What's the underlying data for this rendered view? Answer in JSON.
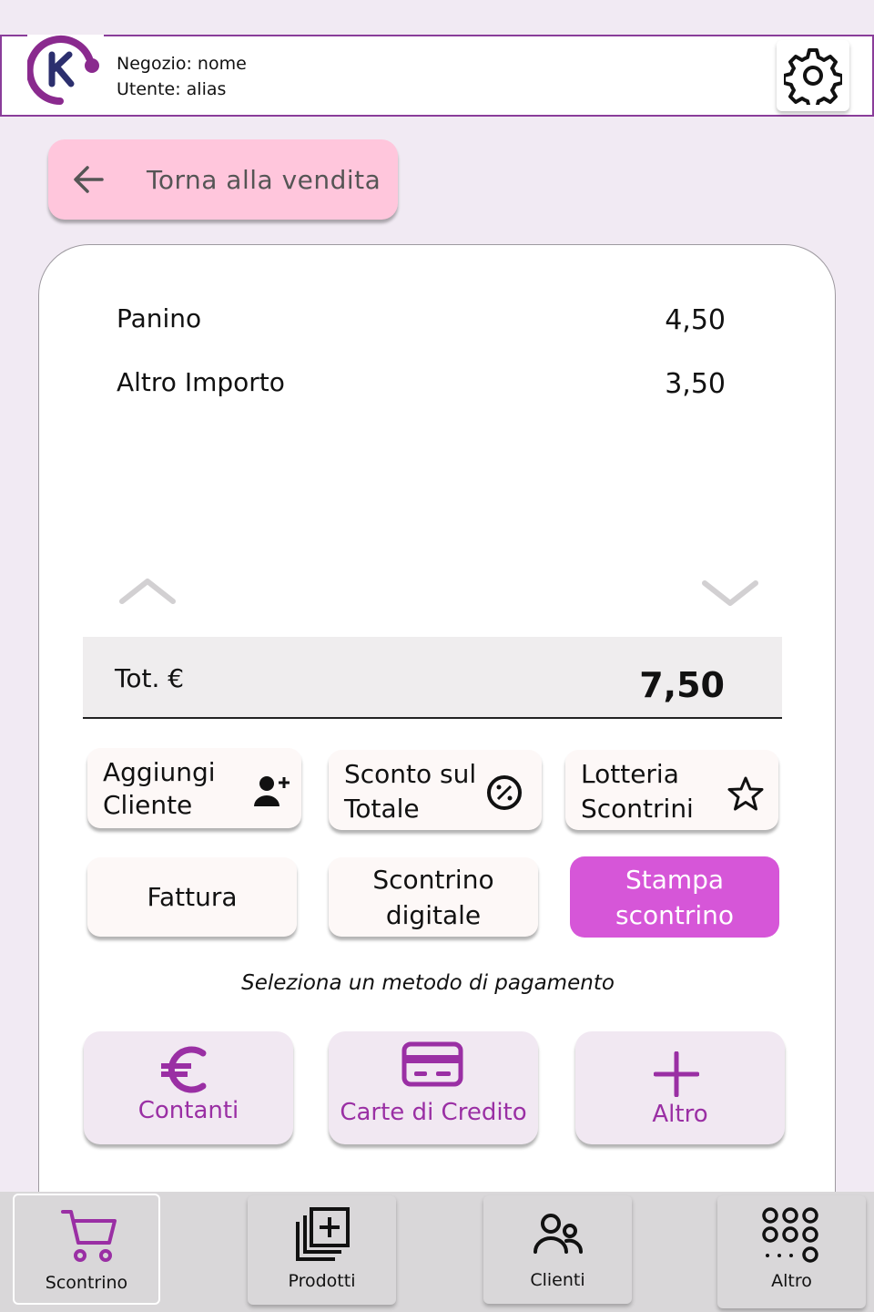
{
  "header": {
    "shop_line": "Negozio: nome",
    "user_line": "Utente: alias"
  },
  "back_button": {
    "label": "Torna  alla vendita"
  },
  "receipt": {
    "items": [
      {
        "name": "Panino",
        "price": "4,50"
      },
      {
        "name": "Altro Importo",
        "price": "3,50"
      }
    ],
    "total_label": "Tot. €",
    "total_value": "7,50"
  },
  "actions": {
    "add_client": {
      "line1": "Aggiungi",
      "line2": "Cliente"
    },
    "discount": {
      "line1": "Sconto sul",
      "line2": "Totale"
    },
    "lottery": {
      "line1": "Lotteria",
      "line2": "Scontrini"
    },
    "invoice": {
      "label": "Fattura"
    },
    "digital_receipt": {
      "line1": "Scontrino",
      "line2": "digitale"
    },
    "print_receipt": {
      "line1": "Stampa",
      "line2": "scontrino"
    }
  },
  "payment": {
    "hint": "Seleziona un metodo di pagamento",
    "methods": [
      {
        "label": "Contanti",
        "icon": "euro-icon"
      },
      {
        "label": "Carte di Credito",
        "icon": "credit-card-icon"
      },
      {
        "label": "Altro",
        "icon": "plus-icon"
      }
    ]
  },
  "nav": {
    "items": [
      {
        "label": "Scontrino",
        "icon": "cart-icon",
        "active": true
      },
      {
        "label": "Prodotti",
        "icon": "products-icon",
        "active": false
      },
      {
        "label": "Clienti",
        "icon": "clients-icon",
        "active": false
      },
      {
        "label": "Altro",
        "icon": "grid-dots-icon",
        "active": false
      }
    ]
  },
  "colors": {
    "brand_purple": "#8a3d9a",
    "accent_magenta": "#d656d8",
    "back_pink": "#ffc6dc",
    "payment_text": "#9a2fa4",
    "logo_navy": "#2c2f6e"
  }
}
